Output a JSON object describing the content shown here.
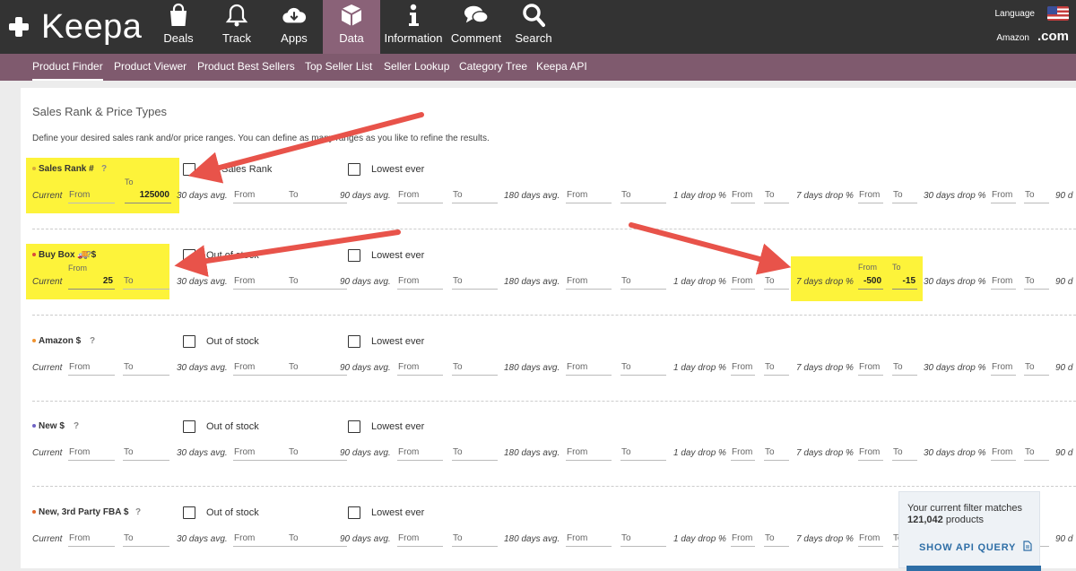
{
  "header": {
    "logo_text": "Keepa",
    "nav": [
      {
        "label": "Deals",
        "icon": "shopping-bag-icon"
      },
      {
        "label": "Track",
        "icon": "bell-icon"
      },
      {
        "label": "Apps",
        "icon": "cloud-download-icon"
      },
      {
        "label": "Data",
        "icon": "cube-icon",
        "active": true
      },
      {
        "label": "Information",
        "icon": "info-icon"
      },
      {
        "label": "Comment",
        "icon": "chat-bubbles-icon"
      },
      {
        "label": "Search",
        "icon": "search-icon"
      }
    ],
    "language_label": "Language",
    "marketplace_label": "Amazon",
    "domain": ".com",
    "flag_icon": "us-flag-icon"
  },
  "subnav": [
    "Product Finder",
    "Product Viewer",
    "Product Best Sellers",
    "Top Seller List",
    "Seller Lookup",
    "Category Tree",
    "Keepa API"
  ],
  "section": {
    "title": "Sales Rank & Price Types",
    "description": "Define your desired sales rank and/or price ranges. You can define as many ranges as you like to refine the results."
  },
  "common": {
    "current": "Current",
    "from": "From",
    "to": "To",
    "help": "?",
    "lowest_ever": "Lowest ever",
    "avg30": "30 days avg.",
    "avg90": "90 days avg.",
    "avg180": "180 days avg.",
    "drop1": "1 day drop %",
    "drop7": "7 days drop %",
    "drop30": "30 days drop %",
    "drop90_partial": "90 d"
  },
  "rows": [
    {
      "label": "Sales Rank #",
      "dot_color": "#d6a93a",
      "checkbox_label": "No Sales Rank",
      "current_from": "",
      "current_to": "125000",
      "drop7_from": "",
      "drop7_to": ""
    },
    {
      "label": "Buy Box 🚚 $",
      "dot_color": "#d94a3a",
      "checkbox_label": "Out of stock",
      "current_from": "25",
      "current_to": "",
      "drop7_from": "-500",
      "drop7_to": "-15"
    },
    {
      "label": "Amazon $",
      "dot_color": "#f0922e",
      "checkbox_label": "Out of stock",
      "current_from": "",
      "current_to": "",
      "drop7_from": "",
      "drop7_to": ""
    },
    {
      "label": "New $",
      "dot_color": "#6f63c4",
      "checkbox_label": "Out of stock",
      "current_from": "",
      "current_to": "",
      "drop7_from": "",
      "drop7_to": ""
    },
    {
      "label": "New, 3rd Party FBA $",
      "dot_color": "#e0682c",
      "checkbox_label": "Out of stock",
      "current_from": "",
      "current_to": "",
      "drop7_from": "",
      "drop7_to": ""
    }
  ],
  "filter_popup": {
    "text": "Your current filter matches",
    "count": "121,042",
    "unit": "products",
    "button": "SHOW API QUERY",
    "button_icon": "document-icon"
  },
  "colors": {
    "topbar": "#333333",
    "subbar": "#7f5a6e",
    "active_tab": "#8a6278",
    "highlight": "#fdf33a",
    "arrow": "#e8534a",
    "accent": "#2e6ea6"
  }
}
